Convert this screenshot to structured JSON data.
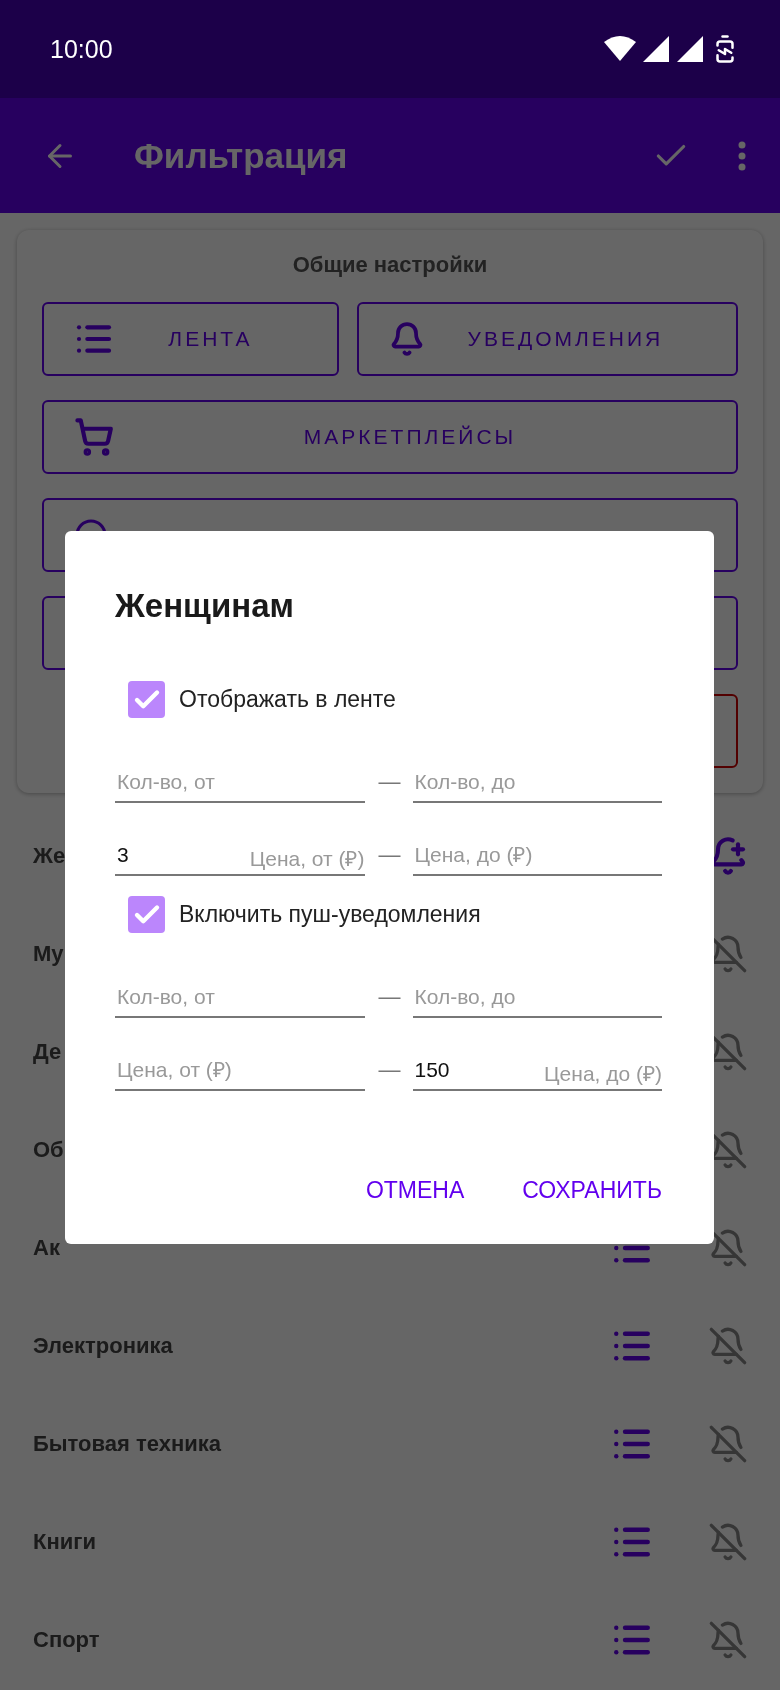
{
  "status_bar": {
    "time": "10:00"
  },
  "app_bar": {
    "title": "Фильтрация"
  },
  "settings": {
    "title": "Общие настройки",
    "buttons": [
      {
        "label": "ЛЕНТА",
        "kind": "feed"
      },
      {
        "label": "УВЕДОМЛЕНИЯ",
        "kind": "bell"
      },
      {
        "label": "МАРКЕТПЛЕЙСЫ",
        "kind": "cart"
      }
    ]
  },
  "categories": [
    {
      "name": "Же",
      "notify": true
    },
    {
      "name": "Му",
      "notify": false
    },
    {
      "name": "Де",
      "notify": false
    },
    {
      "name": "Об",
      "notify": false
    },
    {
      "name": "Ак",
      "feed": true,
      "notify": false
    },
    {
      "name": "Электроника",
      "feed": true,
      "notify": false
    },
    {
      "name": "Бытовая техника",
      "feed": true,
      "notify": false
    },
    {
      "name": "Книги",
      "feed": true,
      "notify": false
    },
    {
      "name": "Спорт",
      "feed": true,
      "notify": false
    }
  ],
  "dialog": {
    "title": "Женщинам",
    "sections": [
      {
        "label": "Отображать в ленте",
        "checked": true,
        "rows": [
          {
            "separator": "—",
            "fields": [
              {
                "hint": "Кол-во, от"
              },
              {
                "hint": "Кол-во, до"
              }
            ]
          },
          {
            "separator": "—",
            "fields": [
              {
                "hint": "Цена, от (₽)",
                "value": "3"
              },
              {
                "hint": "Цена, до (₽)"
              }
            ]
          }
        ]
      },
      {
        "label": "Включить пуш-уведомления",
        "checked": true,
        "rows": [
          {
            "separator": "—",
            "fields": [
              {
                "hint": "Кол-во, от"
              },
              {
                "hint": "Кол-во, до"
              }
            ]
          },
          {
            "separator": "—",
            "fields": [
              {
                "hint": "Цена, от (₽)"
              },
              {
                "hint": "Цена, до (₽)",
                "value": "150"
              }
            ]
          }
        ]
      }
    ],
    "actions": [
      "ОТМЕНА",
      "СОХРАНИТЬ"
    ]
  }
}
